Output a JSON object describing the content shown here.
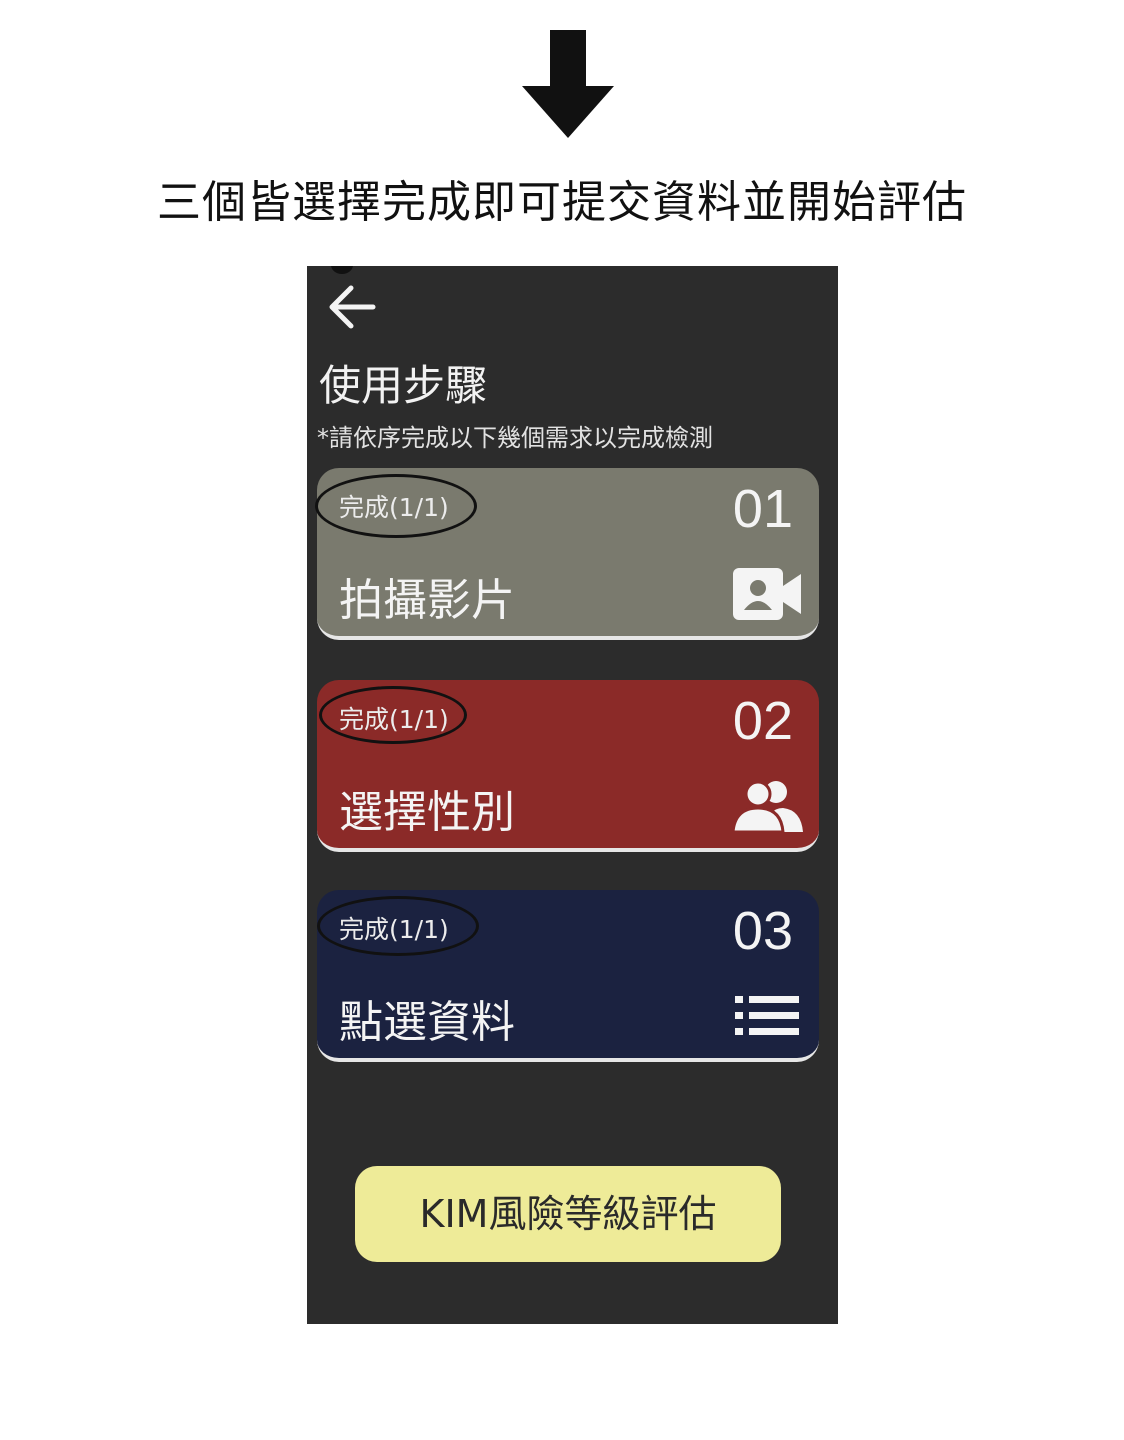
{
  "caption": "三個皆選擇完成即可提交資料並開始評估",
  "screen": {
    "title": "使用步驟",
    "subtitle": "*請依序完成以下幾個需求以完成檢測",
    "cards": [
      {
        "status": "完成(1/1)",
        "number": "01",
        "label": "拍攝影片",
        "icon": "video-camera-icon",
        "color": "#7a7a6e"
      },
      {
        "status": "完成(1/1)",
        "number": "02",
        "label": "選擇性別",
        "icon": "users-icon",
        "color": "#8b2a28"
      },
      {
        "status": "完成(1/1)",
        "number": "03",
        "label": "點選資料",
        "icon": "list-icon",
        "color": "#1b2240"
      }
    ],
    "submit_label": "KIM風險等級評估",
    "submit_color": "#eeeb98"
  }
}
